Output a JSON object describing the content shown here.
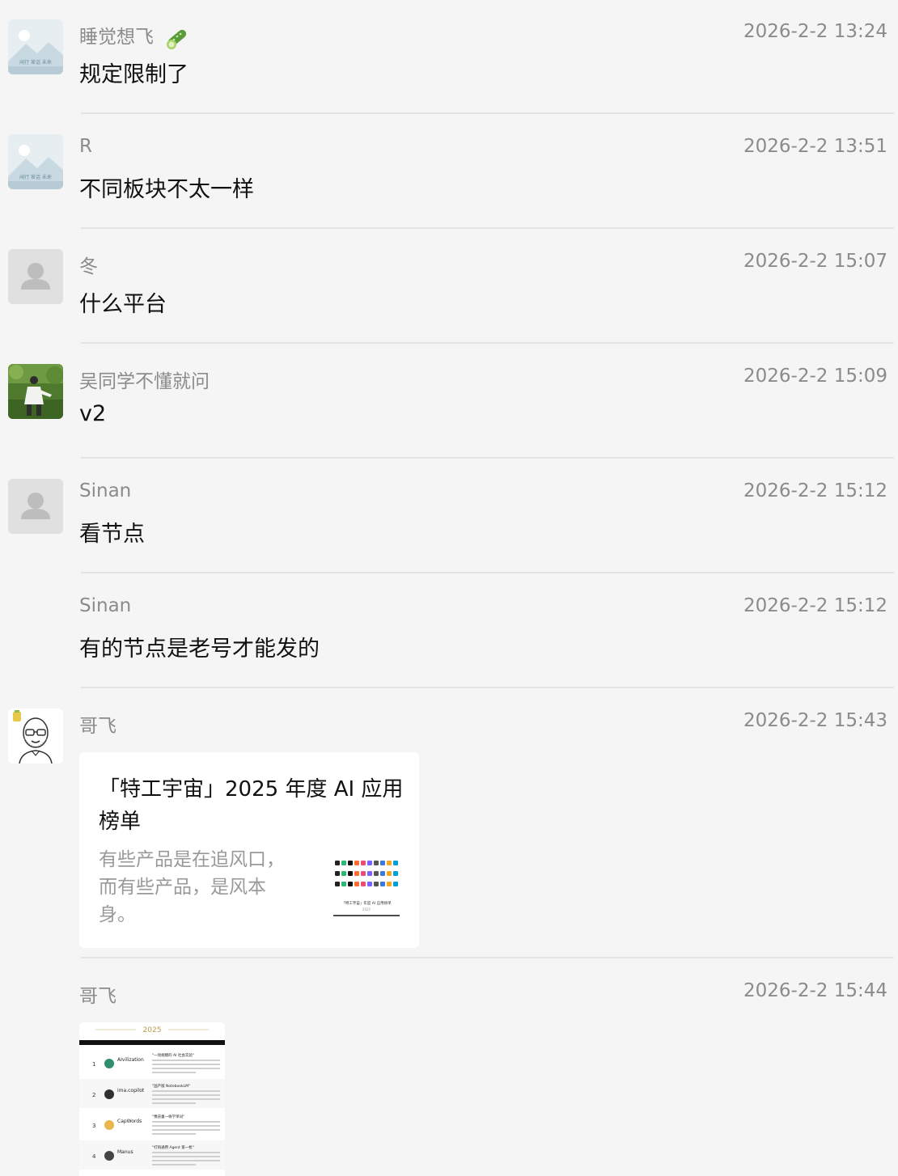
{
  "messages": [
    {
      "name": "睡觉想飞",
      "time": "2026-2-2 13:24",
      "text": "规定限制了",
      "avatar": "landscape-placeholder",
      "avatar_caption": "闲行 笨话 未来"
    },
    {
      "name": "R",
      "time": "2026-2-2 13:51",
      "text": "不同板块不太一样",
      "avatar": "landscape-placeholder",
      "avatar_caption": "闲行 笨话 未来"
    },
    {
      "name": "冬",
      "time": "2026-2-2 15:07",
      "text": "什么平台",
      "avatar": "default-user"
    },
    {
      "name": "吴同学不懂就问",
      "time": "2026-2-2 15:09",
      "text": "v2",
      "avatar": "photo"
    },
    {
      "name": "Sinan",
      "time": "2026-2-2 15:12",
      "text": "看节点",
      "avatar": "default-user"
    },
    {
      "name": "Sinan",
      "time": "2026-2-2 15:12",
      "text": "有的节点是老号才能发的"
    },
    {
      "name": "哥飞",
      "time": "2026-2-2 15:43",
      "avatar": "cartoon-bald-man",
      "card": {
        "title": "「特工宇宙」2025 年度 AI 应用榜单",
        "description": "有些产品是在追风口，而有些产品，是风本身。",
        "thumb_caption": "「特工宇宙」年度 AI 应用榜单",
        "thumb_year": "2025"
      }
    },
    {
      "name": "哥飞",
      "time": "2026-2-2 15:44",
      "image": {
        "year": "2025",
        "rows": [
          {
            "rank": "1",
            "app": "AIvilization",
            "quote": "\"一场规模的 AI 社会实验\""
          },
          {
            "rank": "2",
            "app": "ima.copilot",
            "quote": "\"国产版 NotebookLM\""
          },
          {
            "rank": "3",
            "app": "CapWords",
            "quote": "\"像孩童一样学单词\""
          },
          {
            "rank": "4",
            "app": "Manus",
            "quote": "\"打响通用 Agent 第一枪\""
          }
        ]
      }
    }
  ],
  "colors": {
    "background": "#f5f5f5",
    "name_text": "#8b8b8b",
    "message_text": "#111111",
    "card_background": "#ffffff",
    "divider": "#e3e3e3"
  }
}
